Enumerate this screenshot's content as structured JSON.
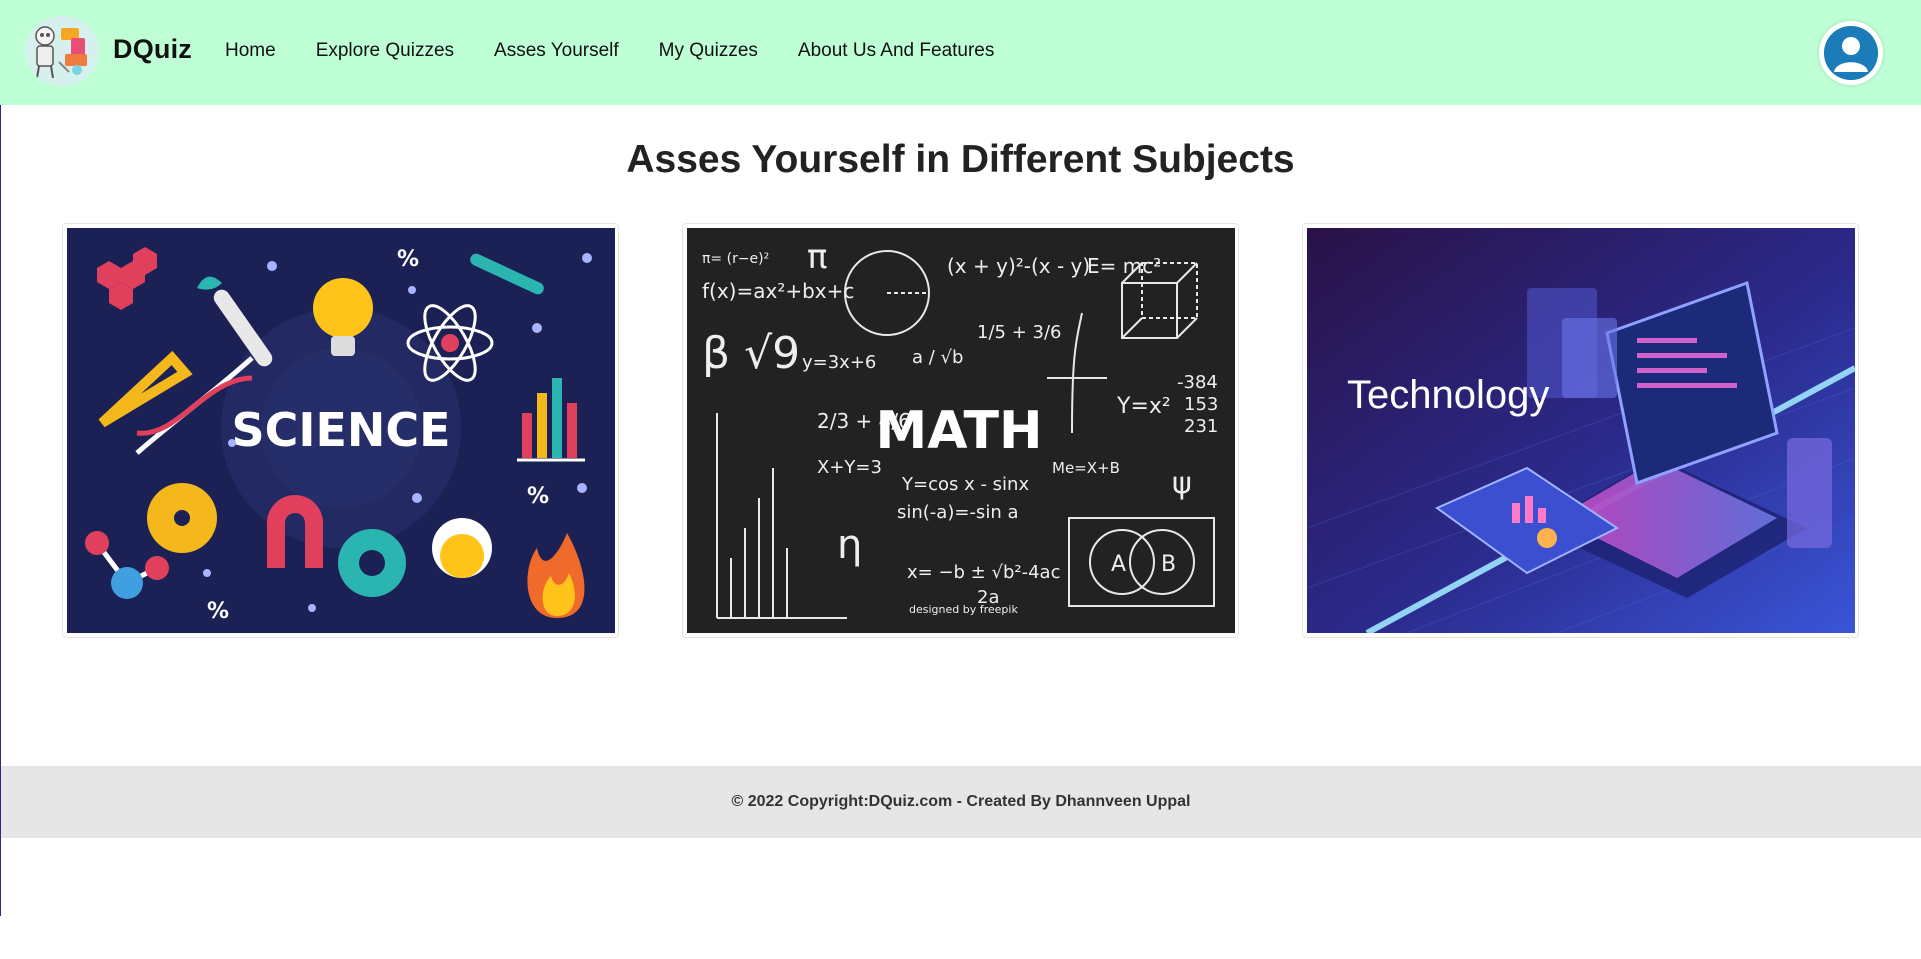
{
  "brand": {
    "name": "DQuiz"
  },
  "nav": {
    "items": [
      {
        "label": "Home"
      },
      {
        "label": "Explore Quizzes"
      },
      {
        "label": "Asses Yourself"
      },
      {
        "label": "My Quizzes"
      },
      {
        "label": "About Us And Features"
      }
    ]
  },
  "profile": {
    "icon": "user-avatar-icon"
  },
  "main": {
    "title": "Asses Yourself in Different Subjects",
    "cards": [
      {
        "label": "SCIENCE",
        "bg": "#1c2155"
      },
      {
        "label": "MATH",
        "bg": "#222222",
        "credit": "designed by freepik"
      },
      {
        "label": "Technology",
        "bg": "#2b1a6e"
      }
    ]
  },
  "footer": {
    "text": "© 2022 Copyright:DQuiz.com - Created By Dhannveen Uppal"
  },
  "colors": {
    "navbar": "#bfffd6",
    "footer": "#e6e6e6",
    "avatar": "#1a7cb8"
  }
}
